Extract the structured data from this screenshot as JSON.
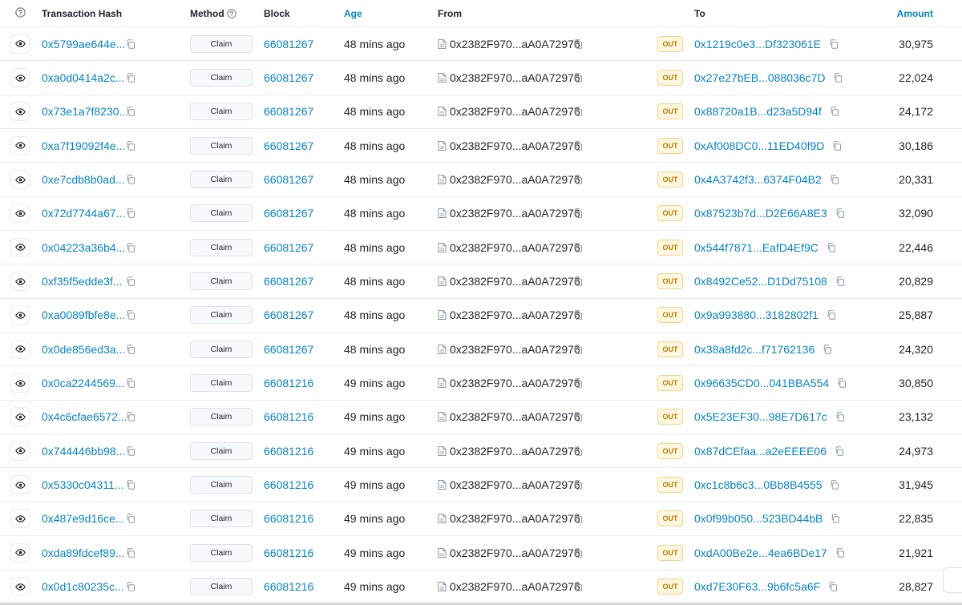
{
  "header": {
    "info_icon": "question-circle-icon",
    "transaction_hash": "Transaction Hash",
    "method": "Method",
    "block": "Block",
    "age": "Age",
    "from": "From",
    "to": "To",
    "amount": "Amount"
  },
  "colors": {
    "link": "#0784c3",
    "out_badge_bg": "#fff7e0",
    "out_badge_text": "#b47d00",
    "border": "#e9ecef"
  },
  "rows": [
    {
      "hash": "0x5799ae644e...",
      "method": "Claim",
      "block": "66081267",
      "age": "48 mins ago",
      "from": "0x2382F970...aA0A72976",
      "direction": "OUT",
      "to": "0x1219c0e3...Df323061E",
      "amount": "30,975"
    },
    {
      "hash": "0xa0d0414a2c...",
      "method": "Claim",
      "block": "66081267",
      "age": "48 mins ago",
      "from": "0x2382F970...aA0A72976",
      "direction": "OUT",
      "to": "0x27e27bEB...088036c7D",
      "amount": "22,024"
    },
    {
      "hash": "0x73e1a7f8230...",
      "method": "Claim",
      "block": "66081267",
      "age": "48 mins ago",
      "from": "0x2382F970...aA0A72976",
      "direction": "OUT",
      "to": "0x88720a1B...d23a5D94f",
      "amount": "24,172"
    },
    {
      "hash": "0xa7f19092f4e...",
      "method": "Claim",
      "block": "66081267",
      "age": "48 mins ago",
      "from": "0x2382F970...aA0A72976",
      "direction": "OUT",
      "to": "0xAf008DC0...11ED40f9D",
      "amount": "30,186"
    },
    {
      "hash": "0xe7cdb8b0ad...",
      "method": "Claim",
      "block": "66081267",
      "age": "48 mins ago",
      "from": "0x2382F970...aA0A72976",
      "direction": "OUT",
      "to": "0x4A3742f3...6374F04B2",
      "amount": "20,331"
    },
    {
      "hash": "0x72d7744a67...",
      "method": "Claim",
      "block": "66081267",
      "age": "48 mins ago",
      "from": "0x2382F970...aA0A72976",
      "direction": "OUT",
      "to": "0x87523b7d...D2E66A8E3",
      "amount": "32,090"
    },
    {
      "hash": "0x04223a36b4...",
      "method": "Claim",
      "block": "66081267",
      "age": "48 mins ago",
      "from": "0x2382F970...aA0A72976",
      "direction": "OUT",
      "to": "0x544f7871...EafD4Ef9C",
      "amount": "22,446"
    },
    {
      "hash": "0xf35f5edde3f...",
      "method": "Claim",
      "block": "66081267",
      "age": "48 mins ago",
      "from": "0x2382F970...aA0A72976",
      "direction": "OUT",
      "to": "0x8492Ce52...D1Dd75108",
      "amount": "20,829"
    },
    {
      "hash": "0xa0089fbfe8e...",
      "method": "Claim",
      "block": "66081267",
      "age": "48 mins ago",
      "from": "0x2382F970...aA0A72976",
      "direction": "OUT",
      "to": "0x9a993880...3182802f1",
      "amount": "25,887"
    },
    {
      "hash": "0x0de856ed3a...",
      "method": "Claim",
      "block": "66081267",
      "age": "48 mins ago",
      "from": "0x2382F970...aA0A72976",
      "direction": "OUT",
      "to": "0x38a8fd2c...f71762136",
      "amount": "24,320"
    },
    {
      "hash": "0x0ca2244569...",
      "method": "Claim",
      "block": "66081216",
      "age": "49 mins ago",
      "from": "0x2382F970...aA0A72976",
      "direction": "OUT",
      "to": "0x96635CD0...041BBA554",
      "amount": "30,850"
    },
    {
      "hash": "0x4c6cfae6572...",
      "method": "Claim",
      "block": "66081216",
      "age": "49 mins ago",
      "from": "0x2382F970...aA0A72976",
      "direction": "OUT",
      "to": "0x5E23EF30...98E7D617c",
      "amount": "23,132"
    },
    {
      "hash": "0x744446bb98...",
      "method": "Claim",
      "block": "66081216",
      "age": "49 mins ago",
      "from": "0x2382F970...aA0A72976",
      "direction": "OUT",
      "to": "0x87dCEfaa...a2eEEEE06",
      "amount": "24,973"
    },
    {
      "hash": "0x5330c04311...",
      "method": "Claim",
      "block": "66081216",
      "age": "49 mins ago",
      "from": "0x2382F970...aA0A72976",
      "direction": "OUT",
      "to": "0xc1c8b6c3...0Bb8B4555",
      "amount": "31,945"
    },
    {
      "hash": "0x487e9d16ce...",
      "method": "Claim",
      "block": "66081216",
      "age": "49 mins ago",
      "from": "0x2382F970...aA0A72976",
      "direction": "OUT",
      "to": "0x0f99b050...523BD44bB",
      "amount": "22,835"
    },
    {
      "hash": "0xda89fdcef89...",
      "method": "Claim",
      "block": "66081216",
      "age": "49 mins ago",
      "from": "0x2382F970...aA0A72976",
      "direction": "OUT",
      "to": "0xdA00Be2e...4ea6BDe17",
      "amount": "21,921"
    },
    {
      "hash": "0x0d1c80235c...",
      "method": "Claim",
      "block": "66081216",
      "age": "49 mins ago",
      "from": "0x2382F970...aA0A72976",
      "direction": "OUT",
      "to": "0xd7E30F63...9b6fc5a6F",
      "amount": "28,827"
    }
  ]
}
